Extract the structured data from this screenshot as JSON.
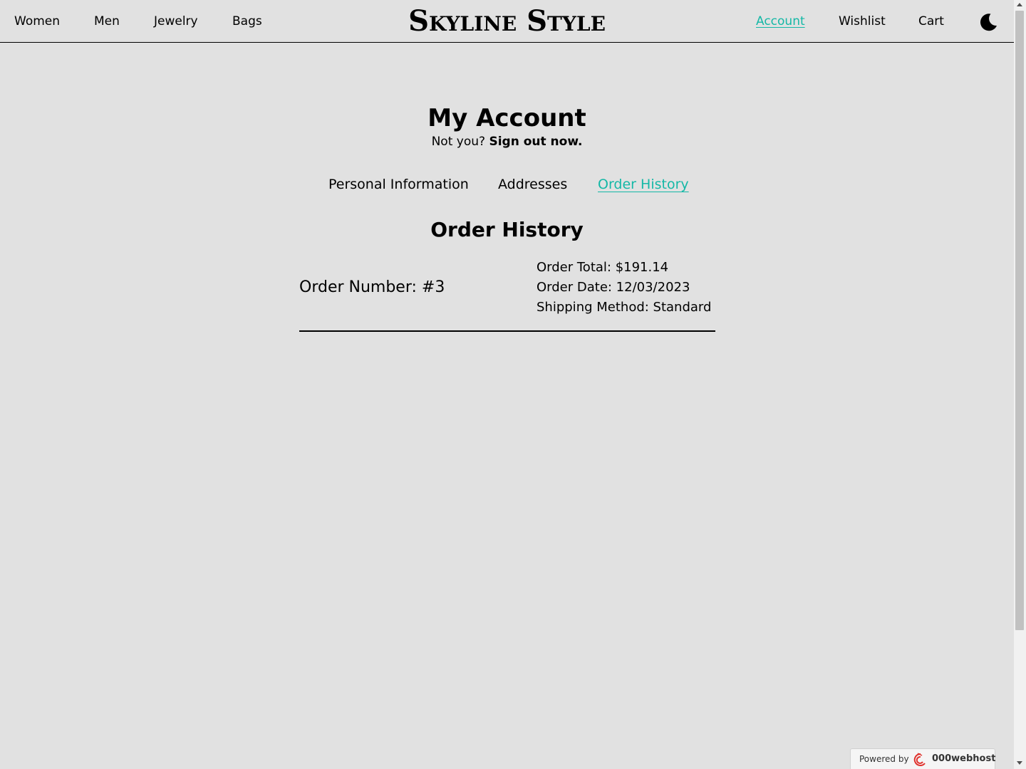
{
  "nav": {
    "left_links": [
      "Women",
      "Men",
      "Jewelry",
      "Bags"
    ],
    "logo": "Skyline Style",
    "right_links": [
      "Account",
      "Wishlist",
      "Cart"
    ],
    "active_link": "Account",
    "theme_toggle_icon": "moon-icon"
  },
  "account": {
    "title": "My Account",
    "signout_prompt": "Not you?",
    "signout_link": "Sign out now.",
    "tabs": [
      "Personal Information",
      "Addresses",
      "Order History"
    ],
    "active_tab": "Order History"
  },
  "order_history": {
    "title": "Order History",
    "orders": [
      {
        "number_label": "Order Number: #3",
        "total": "Order Total: $191.14",
        "date": "Order Date: 12/03/2023",
        "shipping": "Shipping Method: Standard"
      }
    ]
  },
  "footer_badge": {
    "powered_label": "Powered by",
    "host_name": "000webhost"
  },
  "colors": {
    "accent": "#14b8a6",
    "background": "#e1e1e1",
    "text": "#000000"
  }
}
